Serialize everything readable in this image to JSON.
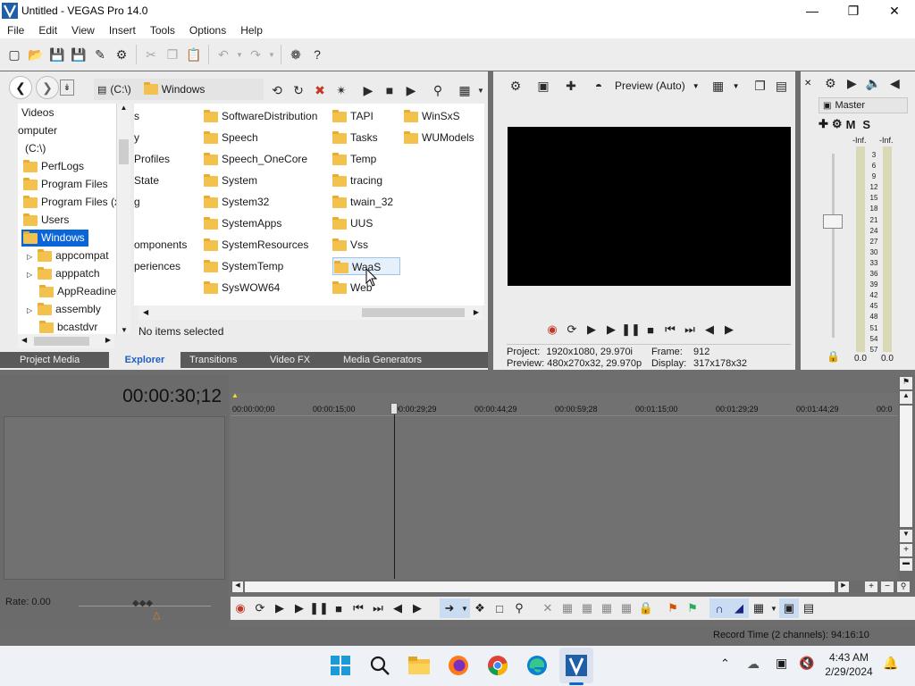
{
  "window": {
    "title": "Untitled - VEGAS Pro 14.0"
  },
  "menu": [
    "File",
    "Edit",
    "View",
    "Insert",
    "Tools",
    "Options",
    "Help"
  ],
  "explorer": {
    "path_drive": "(C:\\)",
    "path_folder": "Windows",
    "tree": [
      {
        "label": "Videos",
        "icon": "video-icon"
      },
      {
        "label": "omputer",
        "icon": "computer-icon"
      },
      {
        "label": "(C:\\)",
        "icon": "drive-icon"
      },
      {
        "label": "PerfLogs",
        "icon": "folder-icon"
      },
      {
        "label": "Program Files",
        "icon": "folder-icon"
      },
      {
        "label": "Program Files (x",
        "icon": "folder-icon"
      },
      {
        "label": "Users",
        "icon": "folder-icon"
      },
      {
        "label": "Windows",
        "icon": "folder-icon",
        "selected": true
      },
      {
        "label": "appcompat",
        "icon": "folder-icon"
      },
      {
        "label": "apppatch",
        "icon": "folder-icon"
      },
      {
        "label": "AppReadine",
        "icon": "folder-icon"
      },
      {
        "label": "assembly",
        "icon": "folder-icon"
      },
      {
        "label": "bcastdvr",
        "icon": "folder-icon"
      }
    ],
    "col0": [
      "s",
      "y",
      "Profiles",
      "State",
      "g",
      "",
      "omponents",
      "periences"
    ],
    "col1": [
      "SoftwareDistribution",
      "Speech",
      "Speech_OneCore",
      "System",
      "System32",
      "SystemApps",
      "SystemResources",
      "SystemTemp",
      "SysWOW64"
    ],
    "col2": [
      "TAPI",
      "Tasks",
      "Temp",
      "tracing",
      "twain_32",
      "UUS",
      "Vss",
      "WaaS",
      "Web"
    ],
    "col3": [
      "WinSxS",
      "WUModels"
    ],
    "status": "No items selected",
    "tabs": [
      "Project Media",
      "Explorer",
      "Transitions",
      "Video FX",
      "Media Generators"
    ],
    "active_tab": "Explorer"
  },
  "preview": {
    "mode": "Preview (Auto)",
    "project_label": "Project:",
    "project_value": "1920x1080, 29.970i",
    "preview_label": "Preview:",
    "preview_value": "480x270x32, 29.970p",
    "frame_label": "Frame:",
    "frame_value": "912",
    "display_label": "Display:",
    "display_value": "317x178x32"
  },
  "master": {
    "label": "Master",
    "m": "M",
    "s": "S",
    "inf_left": "-Inf.",
    "inf_right": "-Inf.",
    "scale": [
      "3",
      "6",
      "9",
      "12",
      "15",
      "18",
      "21",
      "24",
      "27",
      "30",
      "33",
      "36",
      "39",
      "42",
      "45",
      "48",
      "51",
      "54",
      "57"
    ],
    "level_left": "0.0",
    "level_right": "0.0"
  },
  "timeline": {
    "timecode": "00:00:30;12",
    "ruler": [
      "00:00:00;00",
      "00:00:15;00",
      "00:00:29;29",
      "00:00:44;29",
      "00:00:59;28",
      "00:01:15;00",
      "00:01:29;29",
      "00:01:44;29",
      "00:0"
    ],
    "rate": "Rate: 0.00",
    "record_time": "Record Time (2 channels): 94:16:10"
  },
  "taskbar": {
    "time": "4:43 AM",
    "date": "2/29/2024"
  }
}
